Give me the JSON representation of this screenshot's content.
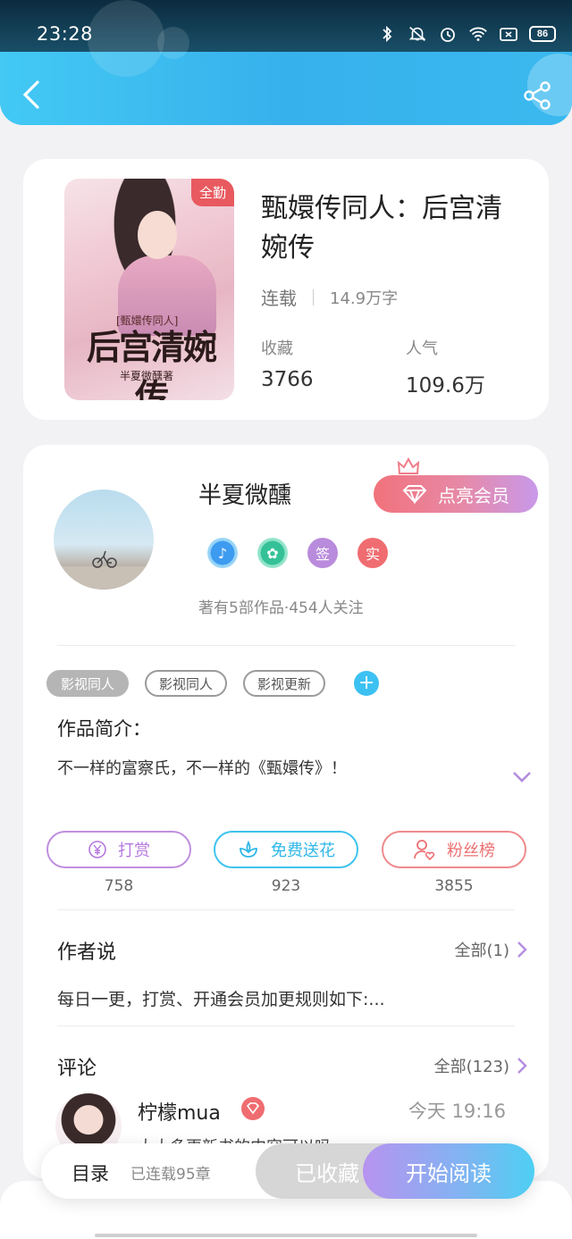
{
  "status_bar": {
    "time": "23:28",
    "battery": "86"
  },
  "book": {
    "title": "甄嬛传同人：后宫清婉传",
    "status": "连载",
    "word_count": "14.9万字",
    "cover_badge": "全勤",
    "cover_subtitle": "[甄嬛传同人]",
    "cover_title": "后宫清婉传",
    "cover_author": "半夏微醺著",
    "favorites_label": "收藏",
    "favorites_value": "3766",
    "popularity_label": "人气",
    "popularity_value": "109.6万"
  },
  "author": {
    "name": "半夏微醺",
    "vip_button": "点亮会员",
    "badges": [
      "♪",
      "✿",
      "签",
      "实"
    ],
    "stats": "著有5部作品·454人关注"
  },
  "tags": [
    "影视同人",
    "影视同人",
    "影视更新"
  ],
  "intro": {
    "title": "作品简介：",
    "text": "不一样的富察氏，不一样的《甄嬛传》！"
  },
  "actions": [
    {
      "label": "打赏",
      "count": "758",
      "icon": "yen-coin-icon"
    },
    {
      "label": "免费送花",
      "count": "923",
      "icon": "flower-icon"
    },
    {
      "label": "粉丝榜",
      "count": "3855",
      "icon": "fan-heart-icon"
    }
  ],
  "author_say": {
    "title": "作者说",
    "more": "全部(1)",
    "text": "每日一更，打赏、开通会员加更规则如下:..."
  },
  "comments": {
    "title": "评论",
    "more": "全部(123)",
    "first": {
      "user": "柠檬mua",
      "time": "今天 19:16",
      "text": "大大多更新书的内容可以吗"
    }
  },
  "bottom_bar": {
    "toc": "目录",
    "toc_status": "已连载95章",
    "favorited": "已收藏",
    "start_reading": "开始阅读"
  },
  "colors": {
    "header_blue": "#3cc4f2",
    "vip_pink": "#f1727b",
    "accent_purple": "#b678df",
    "accent_cyan": "#2fb7e8",
    "accent_red": "#ec7073"
  }
}
